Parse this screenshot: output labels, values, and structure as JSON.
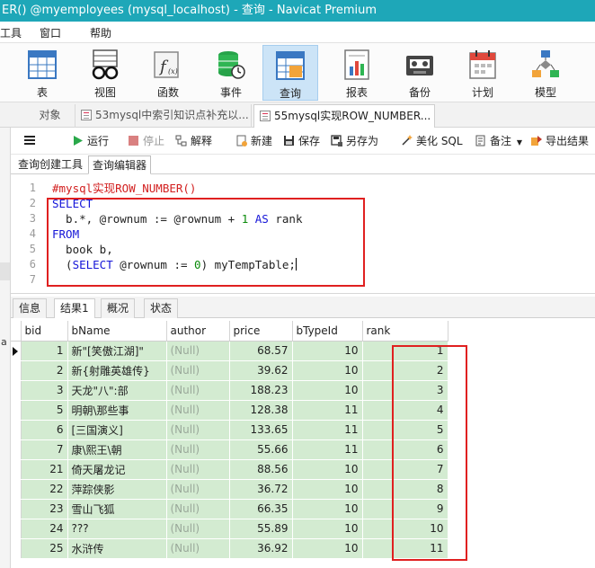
{
  "window": {
    "title": "ER() @myemployees (mysql_localhost) - 查询 - Navicat Premium"
  },
  "menu": [
    "工具",
    "窗口",
    "帮助"
  ],
  "ribbon": [
    {
      "label": "表",
      "icon": "table-icon"
    },
    {
      "label": "视图",
      "icon": "view-glasses-icon"
    },
    {
      "label": "函数",
      "icon": "function-icon"
    },
    {
      "label": "事件",
      "icon": "event-db-clock-icon"
    },
    {
      "label": "查询",
      "icon": "query-table-icon",
      "active": true
    },
    {
      "label": "报表",
      "icon": "report-icon"
    },
    {
      "label": "备份",
      "icon": "backup-tape-icon"
    },
    {
      "label": "计划",
      "icon": "calendar-icon"
    },
    {
      "label": "模型",
      "icon": "model-diagram-icon"
    }
  ],
  "doc_tabs": [
    {
      "label": "对象"
    },
    {
      "label": "53mysql中索引知识点补充以..."
    },
    {
      "label": "55mysql实现ROW_NUMBER...",
      "active": true
    }
  ],
  "query_toolbar": {
    "menu_icon": "hamburger-icon",
    "run": "运行",
    "stop": "停止",
    "explain": "解释",
    "new": "新建",
    "save": "保存",
    "save_as": "另存为",
    "beautify": "美化 SQL",
    "comment": "备注",
    "export": "导出结果"
  },
  "sub_tabs": [
    {
      "label": "查询创建工具"
    },
    {
      "label": "查询编辑器",
      "active": true
    }
  ],
  "editor": {
    "line_numbers": [
      "1",
      "2",
      "3",
      "4",
      "5",
      "6",
      "7"
    ],
    "comment": "#mysql实现ROW_NUMBER()",
    "kw_select": "SELECT",
    "l3_a": "  b.*, @rownum := @rownum + ",
    "l3_num": "1",
    "l3_b": " ",
    "kw_as": "AS",
    "l3_c": " rank",
    "kw_from": "FROM",
    "l5": "  book b,",
    "l6_a": "  (",
    "l6_kw": "SELECT",
    "l6_b": " @rownum := ",
    "l6_num": "0",
    "l6_c": ") myTempTable;"
  },
  "result_tabs": [
    {
      "label": "信息"
    },
    {
      "label": "结果1",
      "active": true
    },
    {
      "label": "概况"
    },
    {
      "label": "状态"
    }
  ],
  "side_strip_char": "a",
  "grid": {
    "columns": [
      "bid",
      "bName",
      "author",
      "price",
      "bTypeId",
      "rank"
    ],
    "rows": [
      [
        "1",
        "新\"[笑傲江湖]\"",
        "(Null)",
        "68.57",
        "10",
        "1"
      ],
      [
        "2",
        "新{射雕英雄传}",
        "(Null)",
        "39.62",
        "10",
        "2"
      ],
      [
        "3",
        "天龙\"八\":部",
        "(Null)",
        "188.23",
        "10",
        "3"
      ],
      [
        "5",
        "明朝\\那些事",
        "(Null)",
        "128.38",
        "11",
        "4"
      ],
      [
        "6",
        "[三国演义]",
        "(Null)",
        "133.65",
        "11",
        "5"
      ],
      [
        "7",
        "康\\熙王\\朝",
        "(Null)",
        "55.66",
        "11",
        "6"
      ],
      [
        "21",
        "倚天屠龙记",
        "(Null)",
        "88.56",
        "10",
        "7"
      ],
      [
        "22",
        "萍踪侠影",
        "(Null)",
        "36.72",
        "10",
        "8"
      ],
      [
        "23",
        "雪山飞狐",
        "(Null)",
        "66.35",
        "10",
        "9"
      ],
      [
        "24",
        "???",
        "(Null)",
        "55.89",
        "10",
        "10"
      ],
      [
        "25",
        "水浒传",
        "(Null)",
        "36.92",
        "10",
        "11"
      ]
    ]
  }
}
